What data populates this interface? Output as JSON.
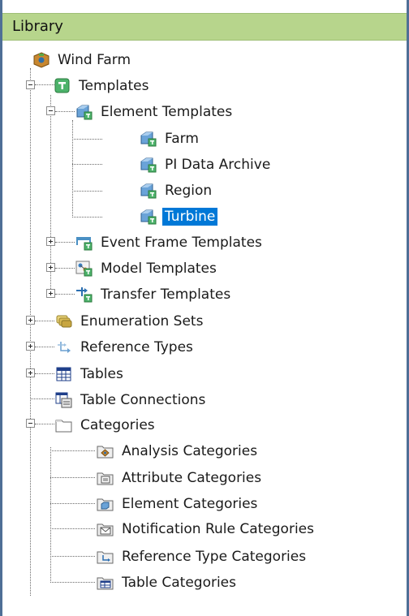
{
  "panel": {
    "title": "Library"
  },
  "tree": {
    "root": "Wind Farm",
    "templates": "Templates",
    "element_templates": "Element Templates",
    "farm": "Farm",
    "pi_data_archive": "PI Data Archive",
    "region": "Region",
    "turbine": "Turbine",
    "event_frame_templates": "Event Frame Templates",
    "model_templates": "Model Templates",
    "transfer_templates": "Transfer Templates",
    "enumeration_sets": "Enumeration Sets",
    "reference_types": "Reference Types",
    "tables": "Tables",
    "table_connections": "Table Connections",
    "categories": "Categories",
    "analysis_categories": "Analysis Categories",
    "attribute_categories": "Attribute Categories",
    "element_categories": "Element Categories",
    "notification_rule_categories": "Notification Rule Categories",
    "reference_type_categories": "Reference Type Categories",
    "table_categories": "Table Categories"
  },
  "selection": {
    "selected_node": "Turbine"
  },
  "colors": {
    "header_bg": "#b7d58c",
    "selection_bg": "#0078d7",
    "border": "#4f6f96"
  }
}
